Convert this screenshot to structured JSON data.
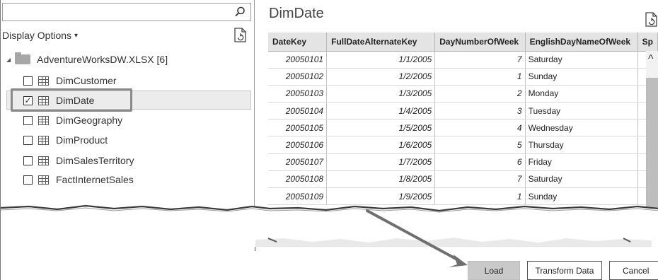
{
  "navigator": {
    "search": {
      "placeholder": "",
      "icon": "search-icon"
    },
    "display_options_label": "Display Options",
    "display_options_caret": "▾",
    "root": {
      "label": "AdventureWorksDW.XLSX [6]"
    },
    "items": [
      {
        "label": "DimCustomer",
        "checked": false
      },
      {
        "label": "DimDate",
        "checked": true
      },
      {
        "label": "DimGeography",
        "checked": false
      },
      {
        "label": "DimProduct",
        "checked": false
      },
      {
        "label": "DimSalesTerritory",
        "checked": false
      },
      {
        "label": "FactInternetSales",
        "checked": false
      }
    ],
    "check_glyph": "✓"
  },
  "preview": {
    "title": "DimDate",
    "columns": [
      "DateKey",
      "FullDateAlternateKey",
      "DayNumberOfWeek",
      "EnglishDayNameOfWeek",
      "Sp"
    ],
    "rows": [
      [
        "20050101",
        "1/1/2005",
        "7",
        "Saturday"
      ],
      [
        "20050102",
        "1/2/2005",
        "1",
        "Sunday"
      ],
      [
        "20050103",
        "1/3/2005",
        "2",
        "Monday"
      ],
      [
        "20050104",
        "1/4/2005",
        "3",
        "Tuesday"
      ],
      [
        "20050105",
        "1/5/2005",
        "4",
        "Wednesday"
      ],
      [
        "20050106",
        "1/6/2005",
        "5",
        "Thursday"
      ],
      [
        "20050107",
        "1/7/2005",
        "6",
        "Friday"
      ],
      [
        "20050108",
        "1/8/2005",
        "7",
        "Saturday"
      ],
      [
        "20050109",
        "1/9/2005",
        "1",
        "Sunday"
      ]
    ],
    "scroll_up_glyph": "^"
  },
  "buttons": {
    "load": "Load",
    "transform": "Transform Data",
    "cancel": "Cancel"
  },
  "colors": {
    "selected_bg": "#ececec",
    "highlight_border": "#8a8a8a",
    "load_bg": "#c9c9c9",
    "arrow": "#6f6f6f"
  }
}
